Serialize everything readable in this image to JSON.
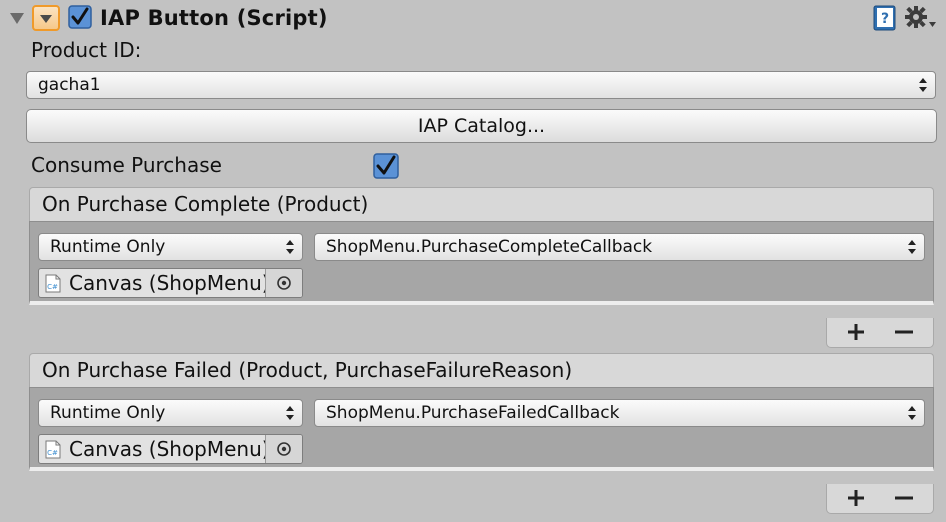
{
  "component": {
    "title": "IAP Button (Script)",
    "enabled": true,
    "icon": "component-icon",
    "help_icon": "help-book-icon",
    "settings_icon": "gear-icon"
  },
  "product_id": {
    "label": "Product ID:",
    "value": "gacha1"
  },
  "catalog_button": {
    "label": "IAP Catalog..."
  },
  "consume_purchase": {
    "label": "Consume Purchase",
    "checked": true
  },
  "events": [
    {
      "header": "On Purchase Complete (Product)",
      "call_state": "Runtime Only",
      "function": "ShopMenu.PurchaseCompleteCallback",
      "target": "Canvas (ShopMenu)"
    },
    {
      "header": "On Purchase Failed (Product, PurchaseFailureReason)",
      "call_state": "Runtime Only",
      "function": "ShopMenu.PurchaseFailedCallback",
      "target": "Canvas (ShopMenu)"
    }
  ],
  "list_controls": {
    "add_icon": "plus-icon",
    "remove_icon": "minus-icon"
  },
  "colors": {
    "background": "#c2c2c2",
    "accent_orange": "#f09a2a",
    "checkbox_blue": "#5b92d6",
    "event_body": "#a6a6a6"
  }
}
